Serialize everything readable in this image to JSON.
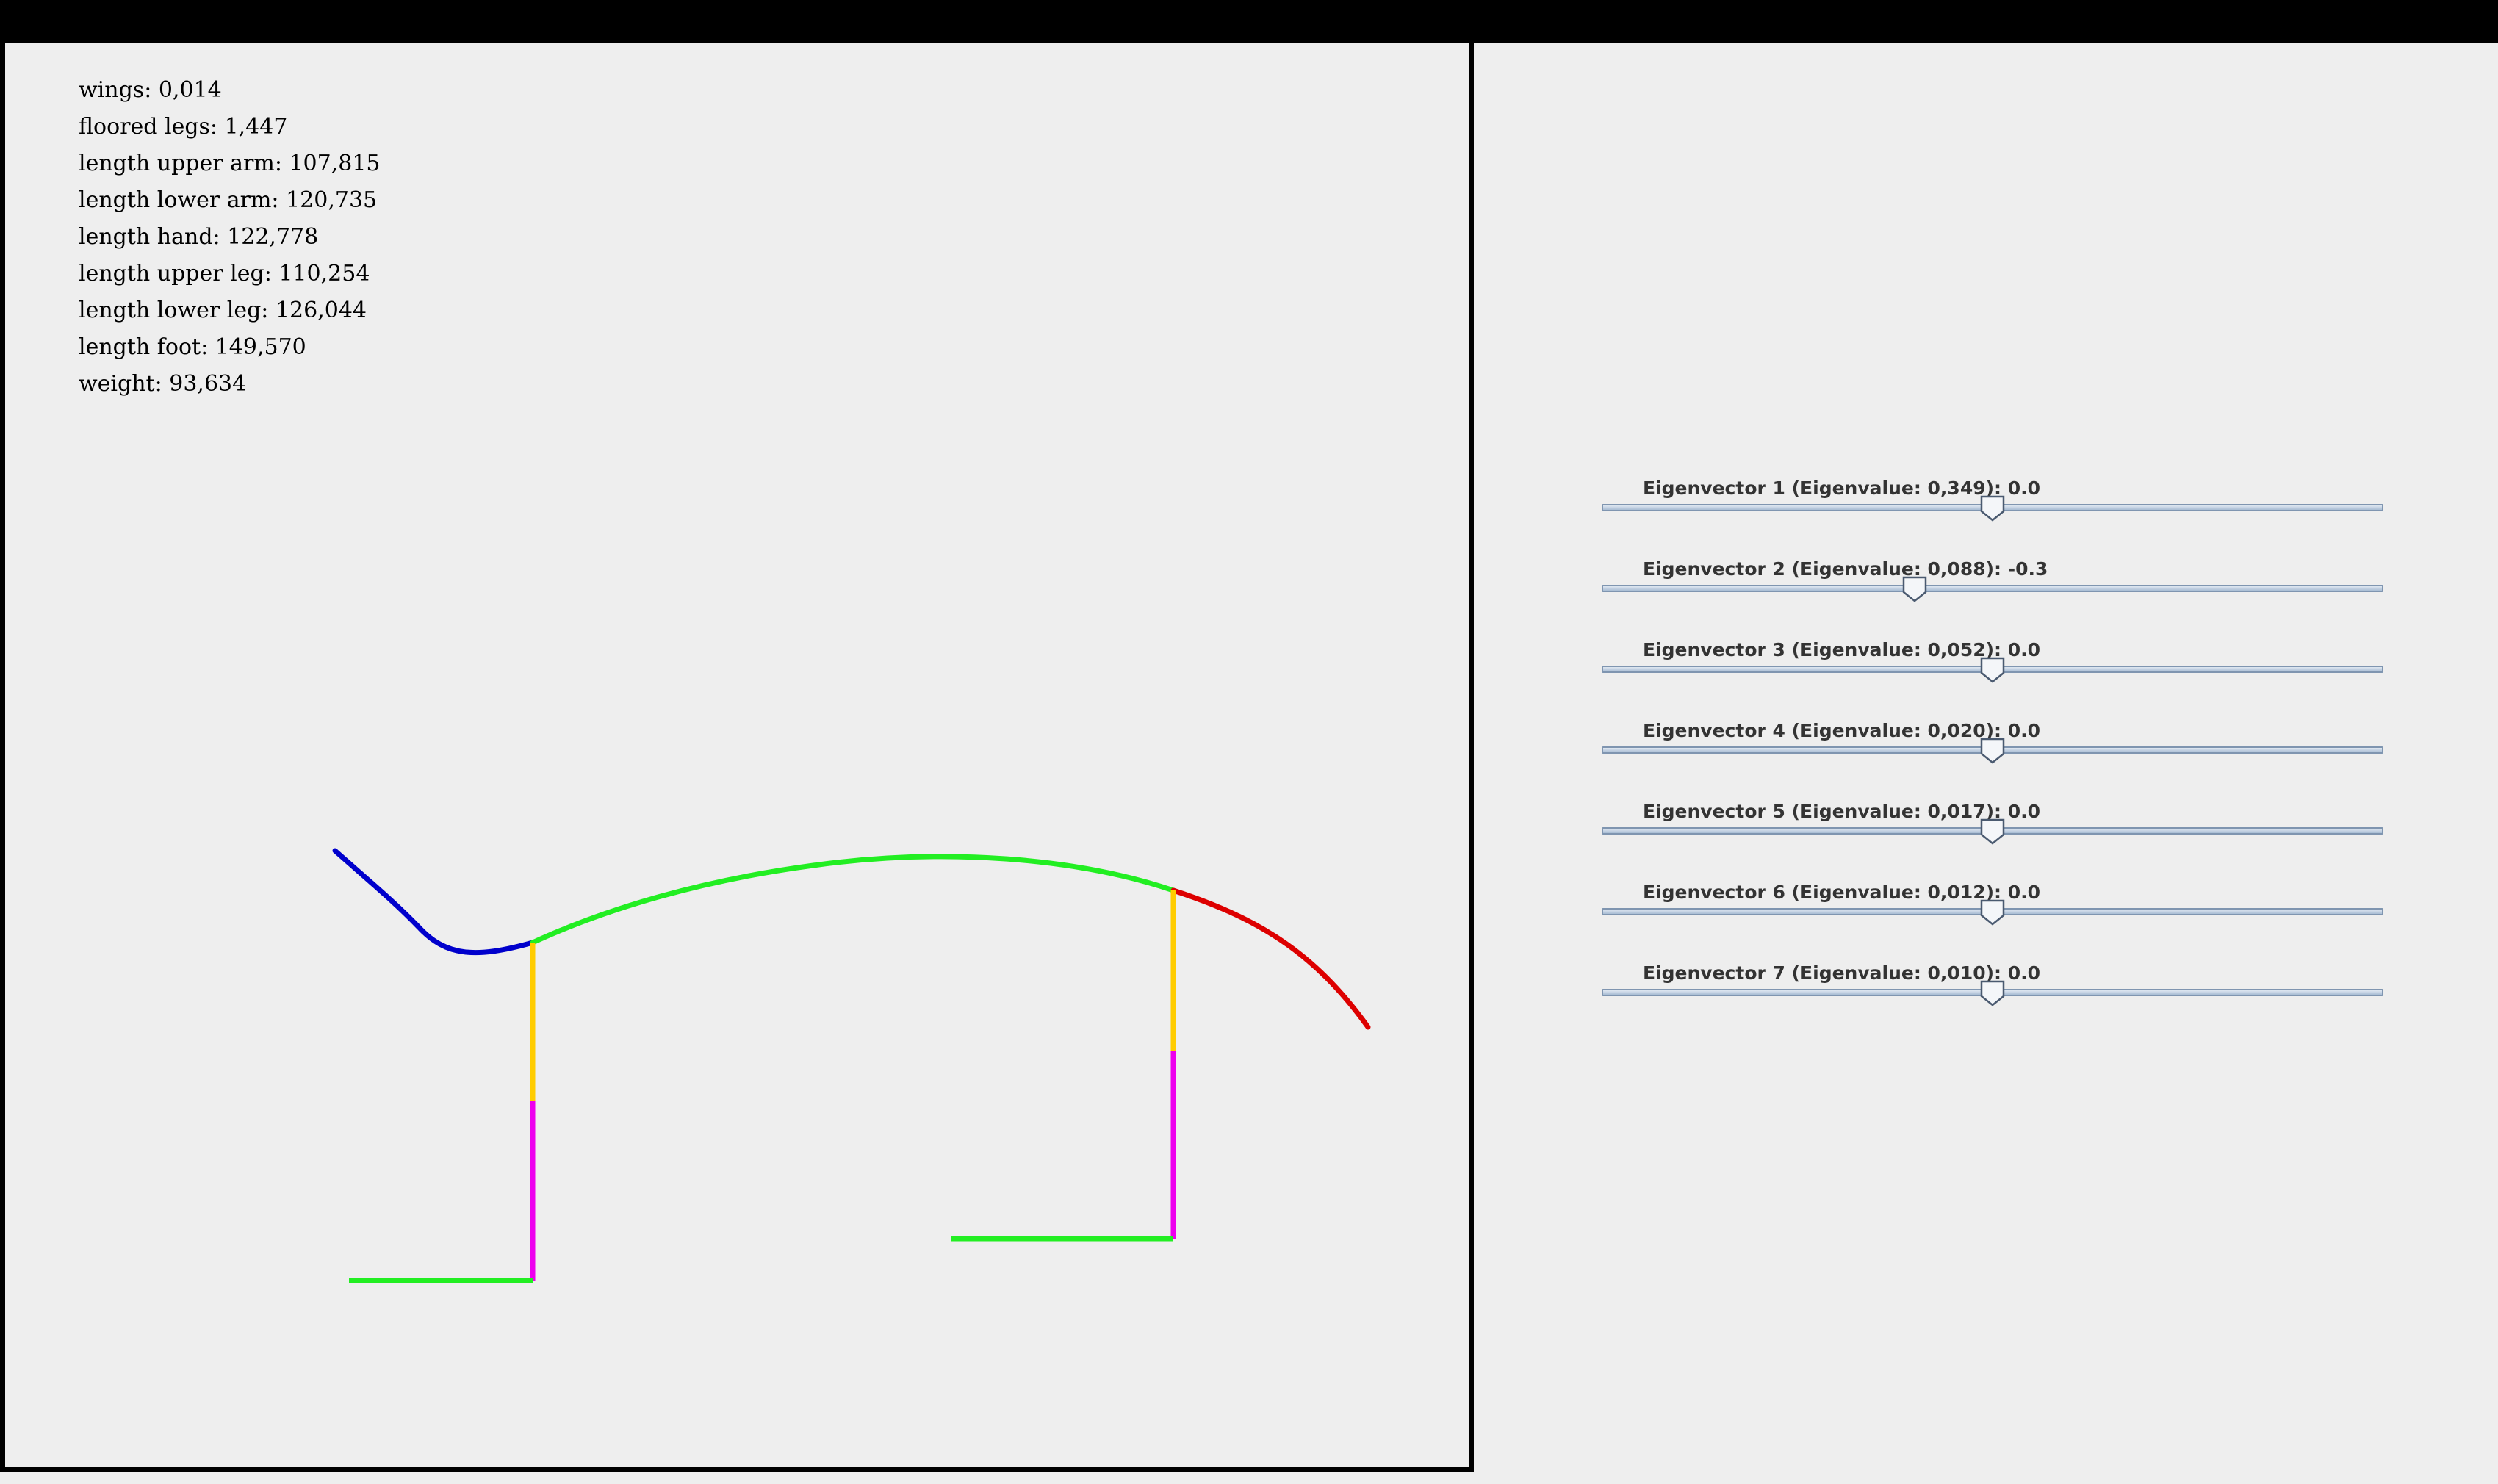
{
  "colors": {
    "head": "#0000cc",
    "spine": "#22ee22",
    "tail": "#dd0000",
    "upper_leg": "#ffcc00",
    "lower_leg": "#ee00ee",
    "foot": "#22ee22",
    "background": "#eeeeee"
  },
  "stats": [
    "wings: 0,014",
    "floored legs: 1,447",
    "length upper arm: 107,815",
    "length lower arm: 120,735",
    "length hand: 122,778",
    "length upper leg: 110,254",
    "length lower leg: 126,044",
    "length foot: 149,570",
    "weight: 93,634"
  ],
  "sliders": [
    {
      "label": "Eigenvector 1 (Eigenvalue: 0,349): 0.0",
      "value": 0.5
    },
    {
      "label": "Eigenvector 2 (Eigenvalue: 0,088): -0.3",
      "value": 0.4
    },
    {
      "label": "Eigenvector 3 (Eigenvalue: 0,052): 0.0",
      "value": 0.5
    },
    {
      "label": "Eigenvector 4 (Eigenvalue: 0,020): 0.0",
      "value": 0.5
    },
    {
      "label": "Eigenvector 5 (Eigenvalue: 0,017): 0.0",
      "value": 0.5
    },
    {
      "label": "Eigenvector 6 (Eigenvalue: 0,012): 0.0",
      "value": 0.5
    },
    {
      "label": "Eigenvector 7 (Eigenvalue: 0,010): 0.0",
      "value": 0.5
    }
  ]
}
